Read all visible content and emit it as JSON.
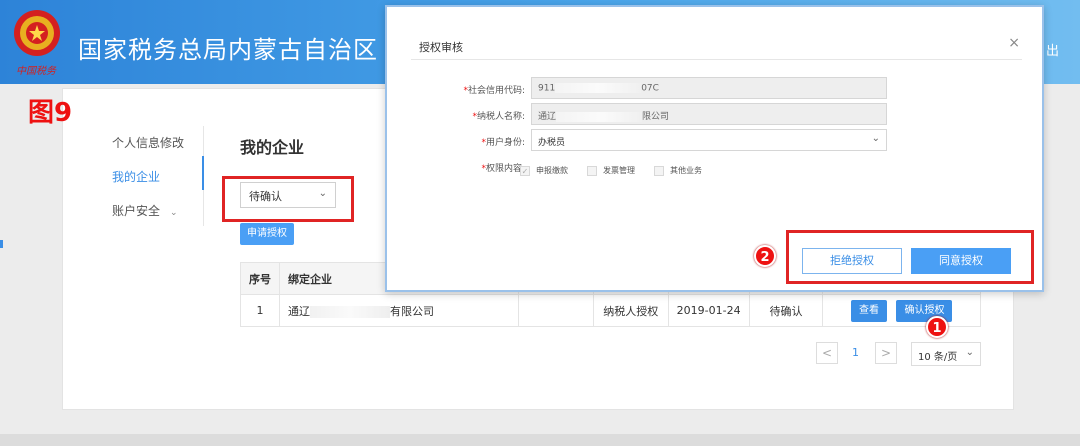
{
  "header": {
    "title": "国家税务总局内蒙古自治区",
    "brand_script": "中国税务",
    "logout_fragment": "出"
  },
  "figure_label": "图9",
  "sidebar": {
    "items": [
      {
        "label": "个人信息修改"
      },
      {
        "label": "我的企业"
      },
      {
        "label": "账户安全"
      }
    ]
  },
  "main": {
    "title": "我的企业",
    "status_filter": "待确认",
    "apply_button": "申请授权"
  },
  "table": {
    "headers": [
      "序号",
      "绑定企业"
    ],
    "rows": [
      {
        "index": "1",
        "company_prefix": "通辽",
        "company_suffix": "有限公司",
        "auth_type": "纳税人授权",
        "date": "2019-01-24",
        "status": "待确认",
        "view_button": "查看",
        "confirm_button": "确认授权"
      }
    ]
  },
  "pagination": {
    "prev": "<",
    "current_page": "1",
    "next": ">",
    "page_size": "10 条/页"
  },
  "markers": {
    "one": "1",
    "two": "2"
  },
  "modal": {
    "title": "授权审核",
    "close": "×",
    "fields": {
      "credit_code": {
        "label": "社会信用代码:",
        "prefix": "911",
        "suffix": "07C"
      },
      "taxpayer_name": {
        "label": "纳税人名称:",
        "prefix": "通辽",
        "suffix": "限公司"
      },
      "user_identity": {
        "label": "用户身份:",
        "value": "办税员"
      },
      "permissions": {
        "label": "权限内容:"
      }
    },
    "permissions": [
      {
        "label": "申报缴款",
        "checked": true
      },
      {
        "label": "发票管理",
        "checked": false
      },
      {
        "label": "其他业务",
        "checked": false
      }
    ],
    "reject_button": "拒绝授权",
    "agree_button": "同意授权"
  },
  "colors": {
    "accent": "#3a8ee6",
    "highlight_red": "#e02424",
    "header_blue": "#2d83d8"
  }
}
